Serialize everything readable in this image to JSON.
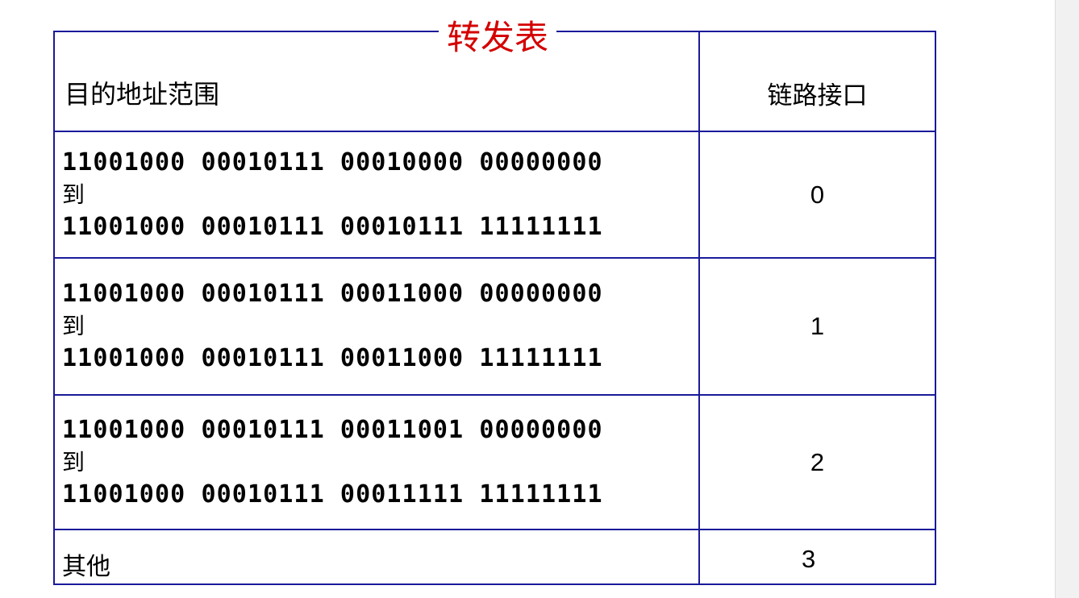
{
  "title": "转发表",
  "colors": {
    "border": "#1a1a9a",
    "title": "#d40000",
    "text": "#000000"
  },
  "header": {
    "range": "目的地址范围",
    "interface": "链路接口"
  },
  "rows": [
    {
      "start": "11001000 00010111 00010000 00000000",
      "sep": "到",
      "end": "11001000 00010111 00010111 11111111",
      "interface": "0"
    },
    {
      "start": "11001000 00010111 00011000 00000000",
      "sep": "到",
      "end": "11001000 00010111 00011000 11111111",
      "interface": "1"
    },
    {
      "start": "11001000 00010111 00011001 00000000",
      "sep": "到",
      "end": "11001000 00010111 00011111 11111111",
      "interface": "2"
    }
  ],
  "otherwise": {
    "label": "其他",
    "interface": "3"
  }
}
